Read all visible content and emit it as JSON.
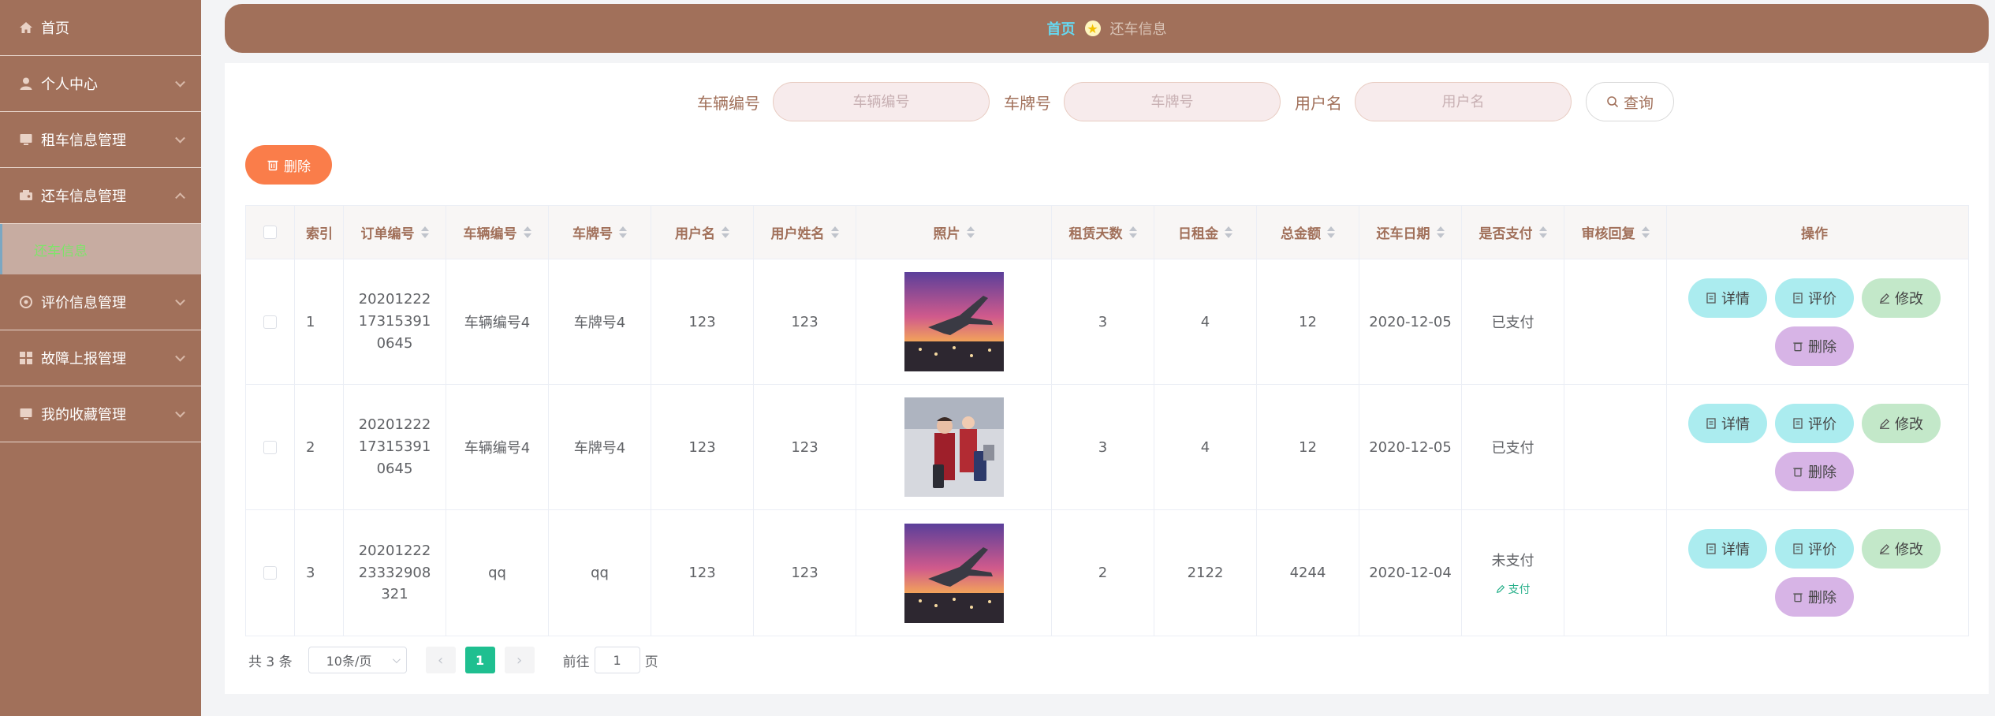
{
  "sidebar": {
    "items": [
      {
        "label": "首页",
        "icon": "home-icon"
      },
      {
        "label": "个人中心",
        "icon": "user-icon"
      },
      {
        "label": "租车信息管理",
        "icon": "monitor-icon"
      },
      {
        "label": "还车信息管理",
        "icon": "car-icon"
      },
      {
        "label": "评价信息管理",
        "icon": "settings-icon"
      },
      {
        "label": "故障上报管理",
        "icon": "grid-icon"
      },
      {
        "label": "我的收藏管理",
        "icon": "monitor-icon"
      }
    ],
    "active_sub": "还车信息"
  },
  "breadcrumb": {
    "home": "首页",
    "current": "还车信息"
  },
  "search": {
    "vehicle_label": "车辆编号",
    "vehicle_placeholder": "车辆编号",
    "plate_label": "车牌号",
    "plate_placeholder": "车牌号",
    "user_label": "用户名",
    "user_placeholder": "用户名",
    "button": "查询"
  },
  "toolbar": {
    "delete_label": "删除"
  },
  "table": {
    "headers": {
      "index": "索引",
      "order": "订单编号",
      "vehicle": "车辆编号",
      "plate": "车牌号",
      "user": "用户名",
      "user_name": "用户姓名",
      "photo": "照片",
      "days": "租赁天数",
      "daily_rent": "日租金",
      "total": "总金额",
      "return_date": "还车日期",
      "paid": "是否支付",
      "reply": "审核回复",
      "ops": "操作"
    },
    "rows": [
      {
        "index": "1",
        "order": "20201222173153910645",
        "vehicle": "车辆编号4",
        "plate": "车牌号4",
        "user": "123",
        "user_name": "123",
        "photo": "airplane",
        "days": "3",
        "daily_rent": "4",
        "total": "12",
        "return_date": "2020-12-05",
        "paid": "已支付",
        "pay_link": "",
        "reply": ""
      },
      {
        "index": "2",
        "order": "20201222173153910645",
        "vehicle": "车辆编号4",
        "plate": "车牌号4",
        "user": "123",
        "user_name": "123",
        "photo": "stewardess",
        "days": "3",
        "daily_rent": "4",
        "total": "12",
        "return_date": "2020-12-05",
        "paid": "已支付",
        "pay_link": "",
        "reply": ""
      },
      {
        "index": "3",
        "order": "2020122223332908321",
        "vehicle": "qq",
        "plate": "qq",
        "user": "123",
        "user_name": "123",
        "photo": "airplane",
        "days": "2",
        "daily_rent": "2122",
        "total": "4244",
        "return_date": "2020-12-04",
        "paid": "未支付",
        "pay_link": "支付",
        "reply": ""
      }
    ],
    "ops": {
      "detail": "详情",
      "rate": "评价",
      "edit": "修改",
      "delete": "删除"
    }
  },
  "pagination": {
    "total": "共 3 条",
    "page_size": "10条/页",
    "current": "1",
    "goto_prefix": "前往",
    "goto_value": "1",
    "goto_suffix": "页"
  },
  "colors": {
    "sidebar": "#a1705a",
    "accent_home": "#66d8f0",
    "delete": "#fa7d4a",
    "pager_active": "#1fbf90"
  }
}
